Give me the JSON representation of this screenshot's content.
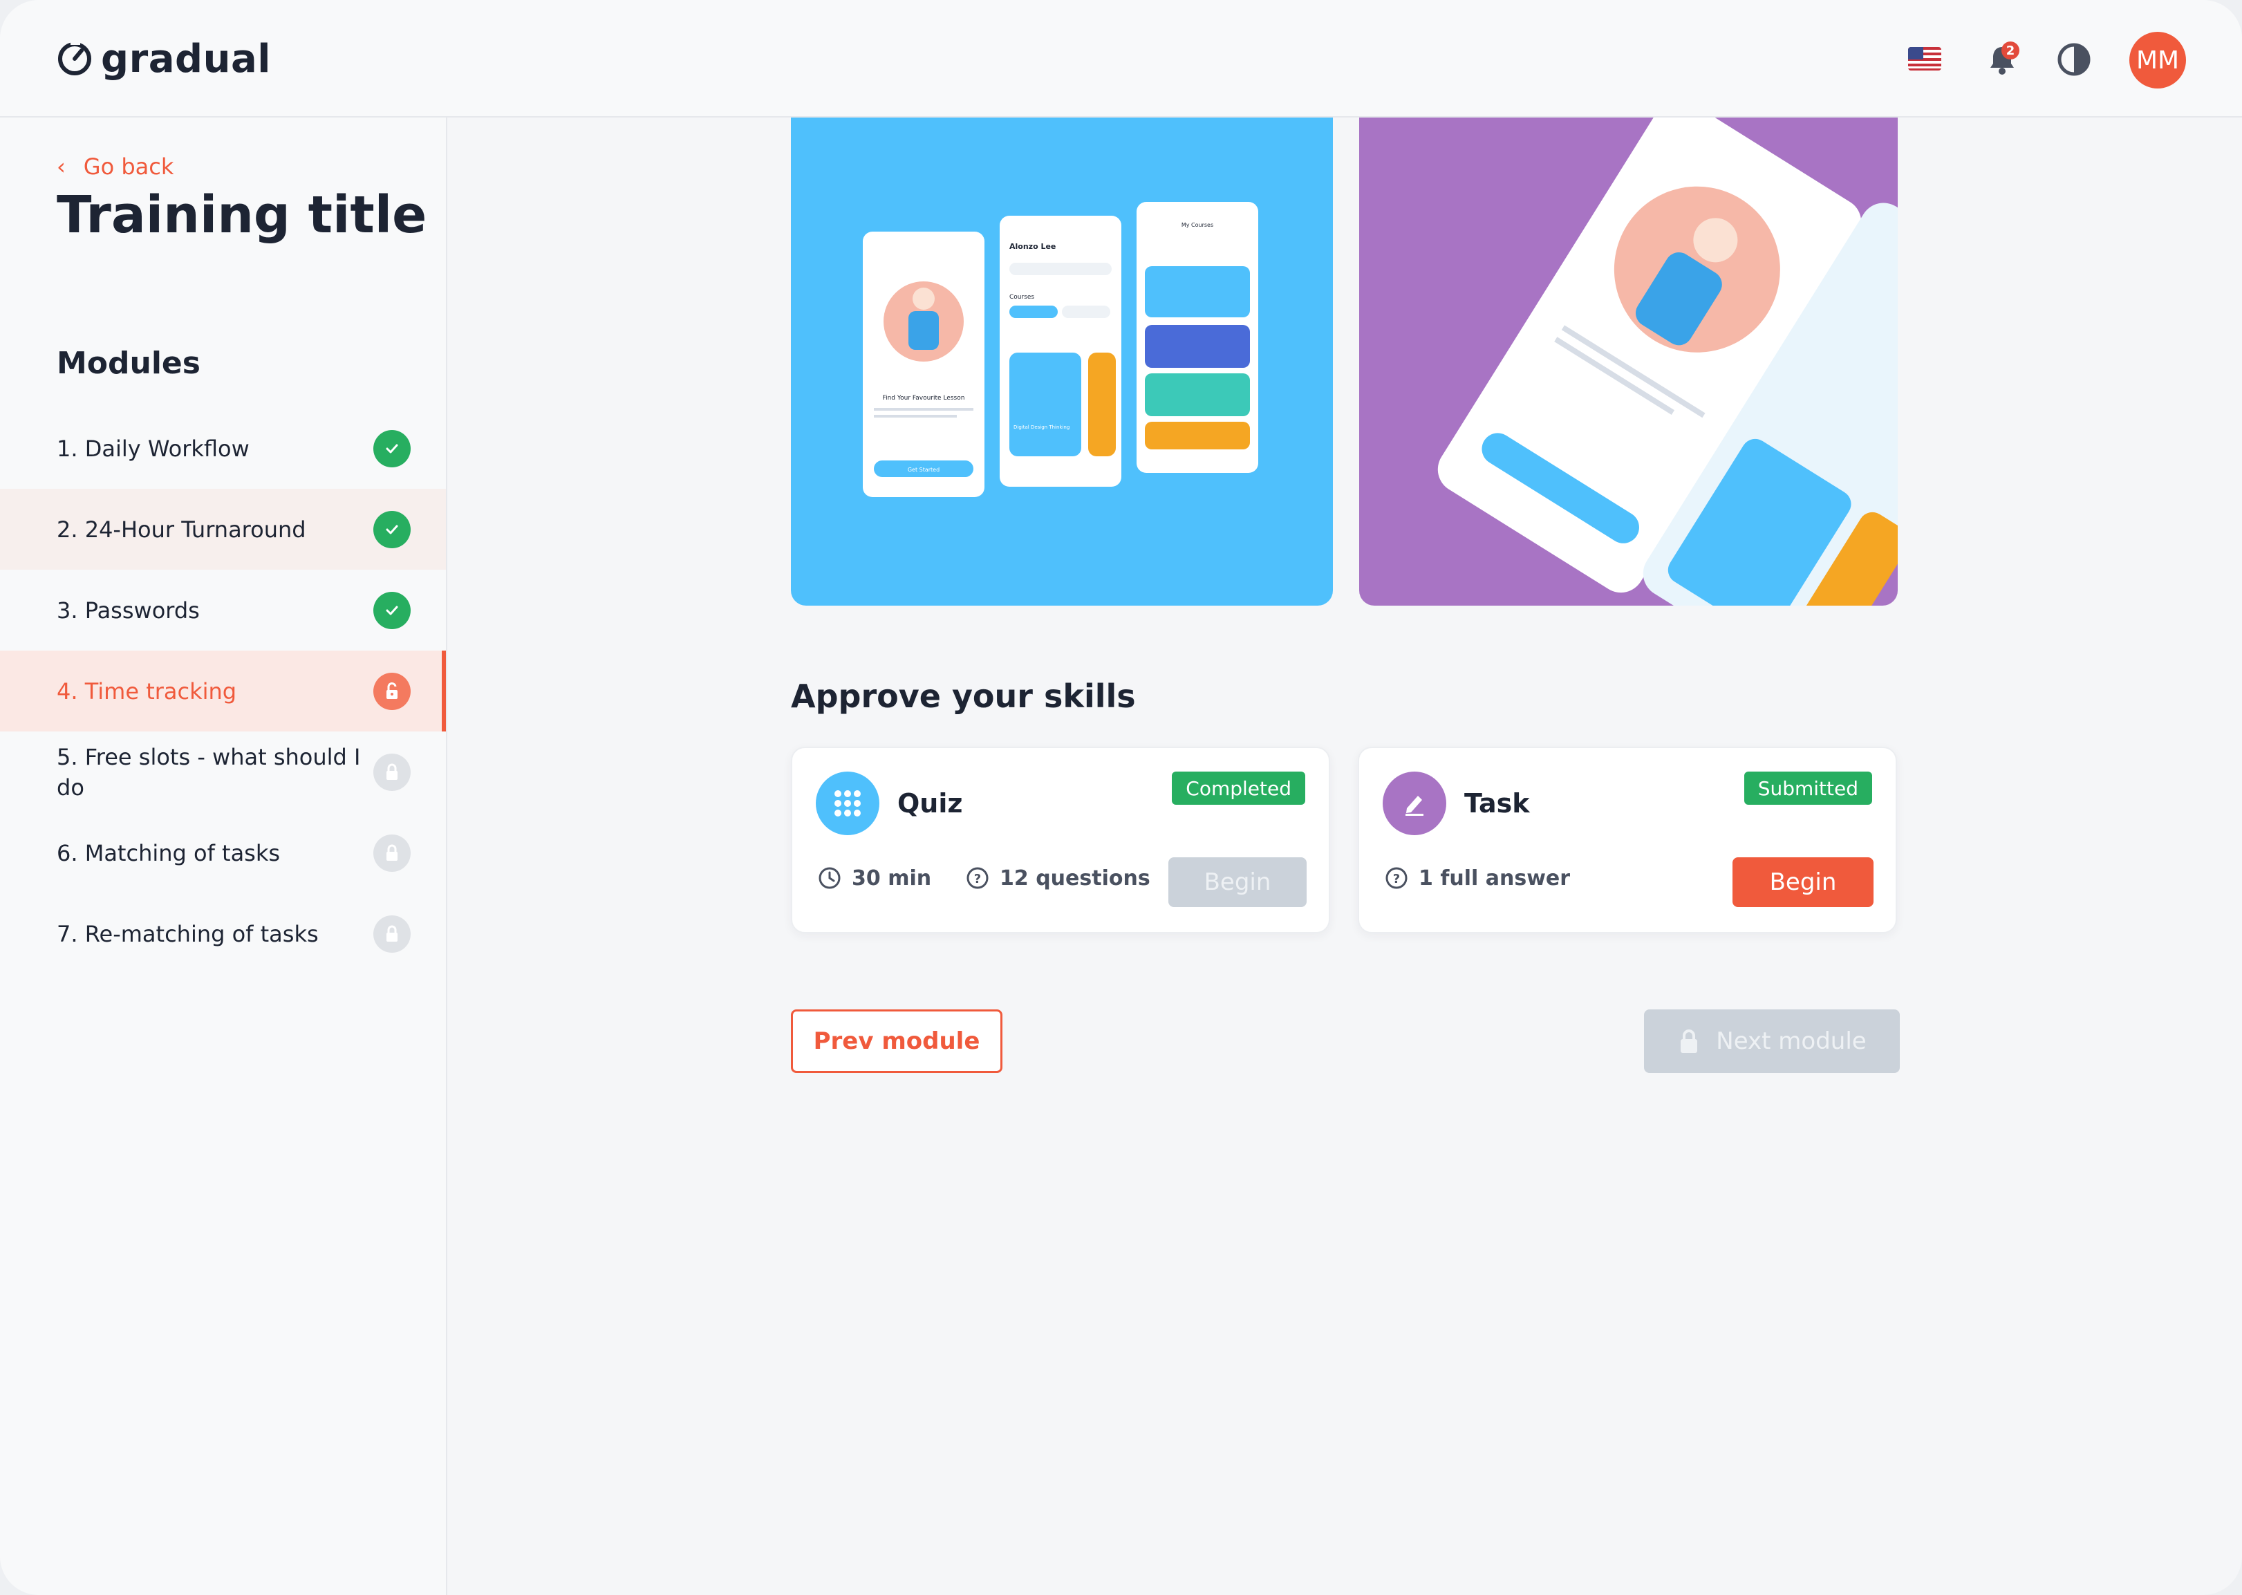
{
  "app": {
    "brand": "gradual",
    "accent": "#f05a3c"
  },
  "header": {
    "flag_icon": "us-flag-icon",
    "notifications": {
      "icon": "bell-icon",
      "count": "2"
    },
    "theme_icon": "contrast-icon",
    "avatar_initials": "MM"
  },
  "sidebar": {
    "go_back": "Go back",
    "training_title": "Training title",
    "modules_heading": "Modules",
    "modules": [
      {
        "label": "1. Daily Workflow",
        "status": "completed"
      },
      {
        "label": "2. 24-Hour Turnaround",
        "status": "completed"
      },
      {
        "label": "3. Passwords",
        "status": "completed"
      },
      {
        "label": "4. Time tracking",
        "status": "active-unlocked"
      },
      {
        "label": "5. Free slots - what should I do",
        "status": "locked"
      },
      {
        "label": "6. Matching of tasks",
        "status": "locked"
      },
      {
        "label": "7. Re-matching of tasks",
        "status": "locked"
      }
    ]
  },
  "main": {
    "section_title": "Approve your skills",
    "quiz": {
      "title": "Quiz",
      "badge": "Completed",
      "duration": "30 min",
      "questions": "12 questions",
      "button": "Begin",
      "icon": "grid-icon"
    },
    "task": {
      "title": "Task",
      "badge": "Submitted",
      "answers": "1 full answer",
      "button": "Begin",
      "icon": "pencil-icon"
    },
    "prev_button": "Prev module",
    "next_button": "Next module"
  },
  "hero": {
    "screen1_text": "Find Your Favourite Lesson",
    "screen1_button": "Get Started",
    "screen2_greeting": "Alonzo Lee",
    "screen2_section": "Courses",
    "screen2_card": "Digital Design Thinking",
    "screen3_title": "My Courses"
  }
}
